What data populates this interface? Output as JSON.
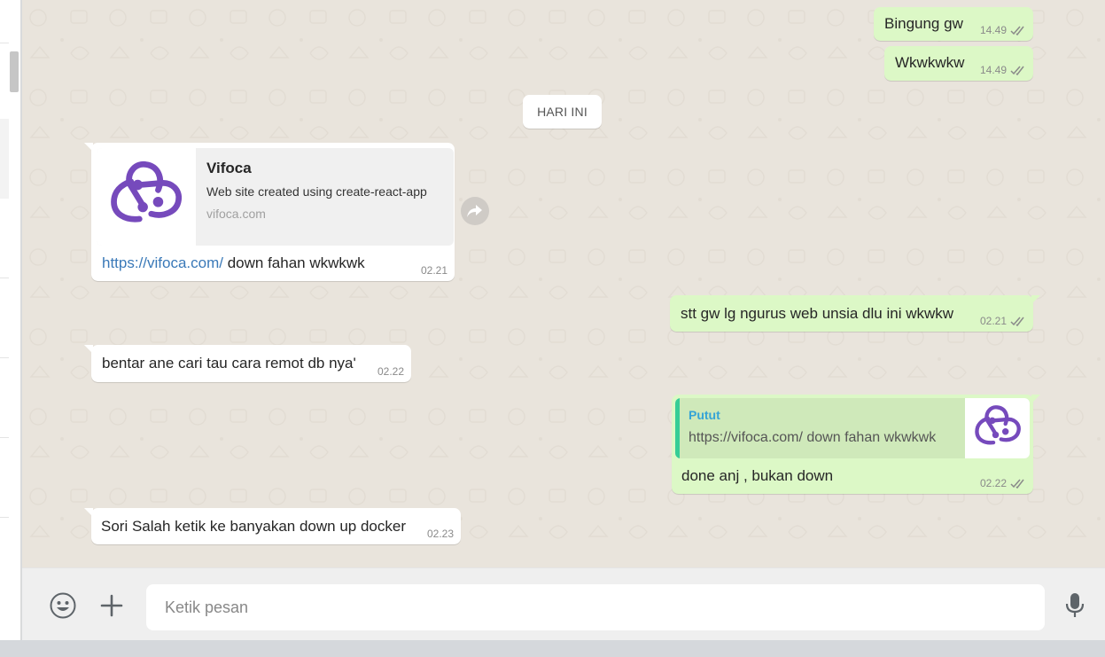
{
  "date_divider": "HARI INI",
  "messages": [
    {
      "id": "m1",
      "direction": "out",
      "text": "Bingung gw",
      "time": "14.49",
      "status": "read"
    },
    {
      "id": "m2",
      "direction": "out",
      "text": "Wkwkwkw",
      "time": "14.49",
      "status": "read"
    },
    {
      "id": "m3",
      "direction": "in",
      "link_preview": {
        "title": "Vifoca",
        "description": "Web site created using create-react-app",
        "domain": "vifoca.com"
      },
      "link": "https://vifoca.com/",
      "text": " down fahan wkwkwk",
      "time": "02.21"
    },
    {
      "id": "m4",
      "direction": "out",
      "text": "stt gw lg ngurus web unsia dlu ini wkwkw",
      "time": "02.21",
      "status": "read"
    },
    {
      "id": "m5",
      "direction": "in",
      "text": "bentar ane cari tau cara remot db nya'",
      "time": "02.22"
    },
    {
      "id": "m6",
      "direction": "out",
      "quote": {
        "author": "Putut",
        "text": "https://vifoca.com/  down fahan wkwkwk"
      },
      "text": "done anj , bukan down",
      "time": "02.22",
      "status": "read"
    },
    {
      "id": "m7",
      "direction": "in",
      "text": "Sori Salah ketik ke banyakan down up docker",
      "time": "02.23"
    }
  ],
  "composer": {
    "placeholder": "Ketik pesan",
    "emoji_icon": "emoji-icon",
    "attach_icon": "plus-icon",
    "mic_icon": "microphone-icon"
  },
  "colors": {
    "outgoing_bubble": "#dcf8c6",
    "incoming_bubble": "#ffffff",
    "chat_background": "#e9e4dc",
    "link": "#3a79b8",
    "read_ticks": "#8a8a8a",
    "quote_author": "#35a4d6",
    "quote_bar": "#35cd96"
  }
}
